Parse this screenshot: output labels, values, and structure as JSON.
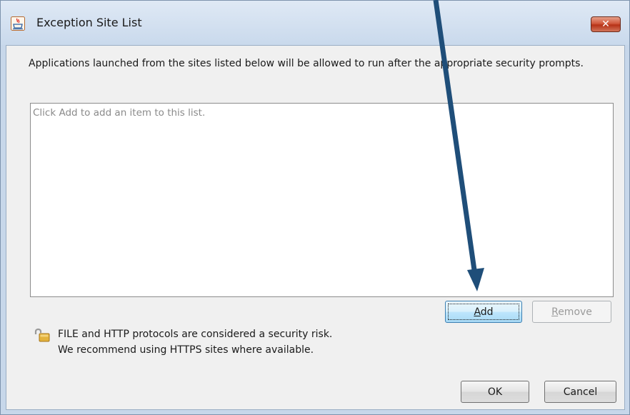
{
  "window": {
    "title": "Exception Site List",
    "title_icon": "java-icon",
    "close_icon": "close-icon"
  },
  "dialog": {
    "description": "Applications launched from the sites listed below will be allowed to run after the appropriate security prompts.",
    "site_list": {
      "placeholder": "Click Add to add an item to this list.",
      "items": []
    },
    "buttons": {
      "add": "Add",
      "remove": "Remove",
      "ok": "OK",
      "cancel": "Cancel"
    },
    "warning": {
      "icon": "unlocked-padlock-icon",
      "line1": "FILE and HTTP protocols are considered a security risk.",
      "line2": "We recommend using HTTPS sites where available."
    }
  },
  "annotation": {
    "icon": "arrow-pointing-to-add-button",
    "color": "#1f4e79"
  }
}
